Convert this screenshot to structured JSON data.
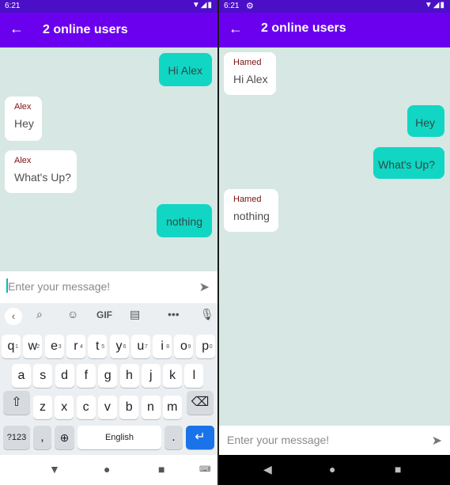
{
  "left": {
    "status_time": "6:21",
    "title": "2 online users",
    "messages": [
      {
        "text": "Hi Alex"
      },
      {
        "sender": "Alex",
        "text": "Hey"
      },
      {
        "sender": "Alex",
        "text": "What's Up?"
      },
      {
        "text": "nothing"
      }
    ],
    "input_placeholder": "Enter your message!",
    "keyboard": {
      "toolbar_gif": "GIF",
      "row1": [
        "q",
        "w",
        "e",
        "r",
        "t",
        "y",
        "u",
        "i",
        "o",
        "p"
      ],
      "row1_hints": [
        "1",
        "2",
        "3",
        "4",
        "5",
        "6",
        "7",
        "8",
        "9",
        "0"
      ],
      "row2": [
        "a",
        "s",
        "d",
        "f",
        "g",
        "h",
        "j",
        "k",
        "l"
      ],
      "row3": [
        "z",
        "x",
        "c",
        "v",
        "b",
        "n",
        "m"
      ],
      "sym_label": "?123",
      "comma_label": ",",
      "space_label": "English",
      "period_label": "."
    }
  },
  "right": {
    "status_time": "6:21",
    "title": "2 online users",
    "messages": [
      {
        "sender": "Hamed",
        "text": "Hi Alex"
      },
      {
        "text": "Hey"
      },
      {
        "text": "What's Up?"
      },
      {
        "sender": "Hamed",
        "text": "nothing"
      }
    ],
    "input_placeholder": "Enter your message!"
  },
  "colors": {
    "app_bar": "#6a00ee",
    "status_bar": "#4a0fc7",
    "chat_background": "#d6e7e4",
    "outgoing_bubble": "#11d6c3",
    "incoming_bubble": "#ffffff",
    "sender_name": "#7a1010"
  },
  "icons": {
    "back": "arrow-left-icon",
    "send": "send-icon",
    "settings": "gear-icon",
    "wifi": "wifi-icon",
    "signal": "signal-icon",
    "battery": "battery-icon"
  }
}
